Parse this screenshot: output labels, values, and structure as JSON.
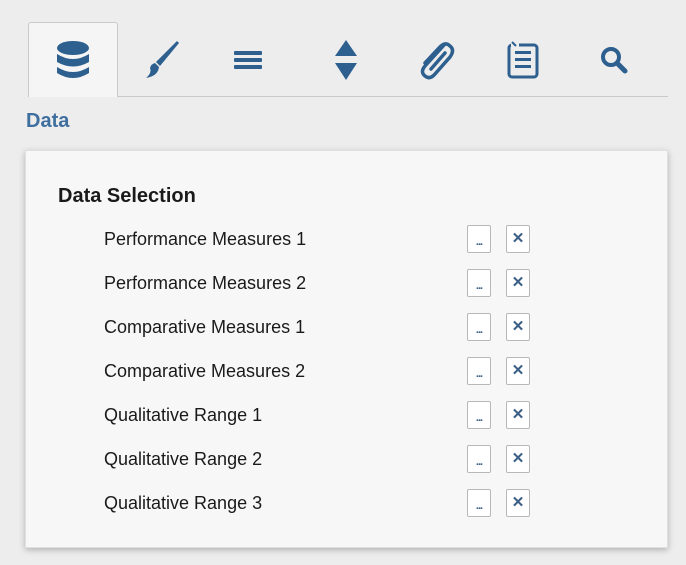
{
  "tabs": [
    {
      "name": "database-icon",
      "active": true
    },
    {
      "name": "paintbrush-icon",
      "active": false
    },
    {
      "name": "menu-icon",
      "active": false
    },
    {
      "name": "sort-icon",
      "active": false
    },
    {
      "name": "paperclip-icon",
      "active": false
    },
    {
      "name": "list-icon",
      "active": false
    },
    {
      "name": "search-icon",
      "active": false
    }
  ],
  "section_title": "Data",
  "panel": {
    "heading": "Data Selection",
    "rows": [
      {
        "label": "Performance Measures 1",
        "more": "...",
        "clear": "✕"
      },
      {
        "label": "Performance Measures 2",
        "more": "...",
        "clear": "✕"
      },
      {
        "label": "Comparative Measures 1",
        "more": "...",
        "clear": "✕"
      },
      {
        "label": "Comparative Measures 2",
        "more": "...",
        "clear": "✕"
      },
      {
        "label": "Qualitative Range 1",
        "more": "...",
        "clear": "✕"
      },
      {
        "label": "Qualitative Range 2",
        "more": "...",
        "clear": "✕"
      },
      {
        "label": "Qualitative Range 3",
        "more": "...",
        "clear": "✕"
      }
    ]
  },
  "colors": {
    "icon": "#2d5f8f",
    "title": "#3f6f9f",
    "background": "#ededed",
    "panel": "#f7f7f7"
  }
}
